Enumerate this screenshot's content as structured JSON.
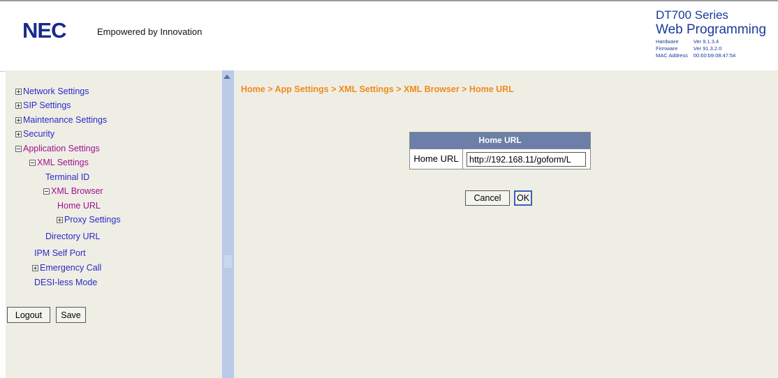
{
  "header": {
    "logo": "NEC",
    "tagline": "Empowered by Innovation",
    "product_series": "DT700 Series",
    "product_name": "Web Programming",
    "info": [
      {
        "label": "Hardware",
        "value": "Ver 9.1.3.4"
      },
      {
        "label": "Firmware",
        "value": "Ver 91.3.2.0"
      },
      {
        "label": "MAC Address",
        "value": "00:60:b9:08:47:54"
      }
    ]
  },
  "sidebar": {
    "tree": [
      {
        "label": "Network Settings",
        "expander": "plus"
      },
      {
        "label": "SIP Settings",
        "expander": "plus"
      },
      {
        "label": "Maintenance Settings",
        "expander": "plus"
      },
      {
        "label": "Security",
        "expander": "plus"
      },
      {
        "label": "Application Settings",
        "expander": "minus"
      },
      {
        "label": "XML Settings",
        "expander": "minus"
      },
      {
        "label": "Terminal ID",
        "expander": "none"
      },
      {
        "label": "XML Browser",
        "expander": "minus"
      },
      {
        "label": "Home URL",
        "expander": "none"
      },
      {
        "label": "Proxy Settings",
        "expander": "plus"
      },
      {
        "label": "Directory URL",
        "expander": "none"
      },
      {
        "label": "IPM Self Port",
        "expander": "none"
      },
      {
        "label": "Emergency Call",
        "expander": "plus"
      },
      {
        "label": "DESI-less Mode",
        "expander": "none"
      }
    ],
    "logout_label": "Logout",
    "save_label": "Save"
  },
  "main": {
    "breadcrumb": "Home > App Settings > XML Settings > XML Browser > Home URL",
    "form": {
      "title": "Home URL",
      "field_label": "Home URL",
      "field_value": "http://192.168.11/goform/L"
    },
    "cancel_label": "Cancel",
    "ok_label": "OK"
  },
  "colors": {
    "breadcrumb": "#f08a1c",
    "panel_bg": "#efeee5",
    "table_header": "#6b7fa8",
    "link_blue": "#2a2ac8",
    "link_purple": "#a01090",
    "brand_blue": "#1a2a8c"
  }
}
